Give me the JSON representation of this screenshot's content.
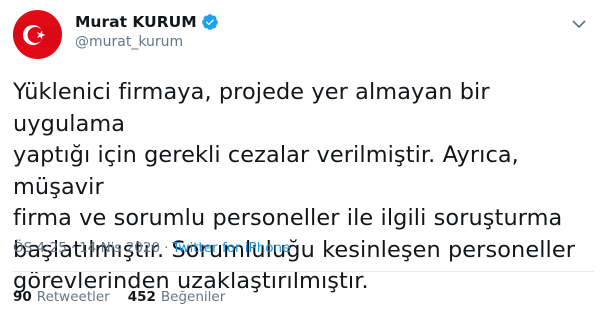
{
  "author": {
    "display_name": "Murat KURUM",
    "handle": "@murat_kurum",
    "verified": true,
    "avatar_icon": "turkish-flag-avatar",
    "avatar_colors": {
      "field": "#e30a17",
      "emblem": "#ffffff"
    }
  },
  "tweet": {
    "lines": [
      "Yüklenici firmaya, projede yer almayan bir uygulama",
      "yaptığı için gerekli cezalar verilmiştir. Ayrıca, müşavir",
      "firma ve sorumlu personeller ile ilgili soruşturma",
      "başlatılmıştır. Sorumluluğu kesinleşen personeller",
      "görevlerinden uzaklaştırılmıştır."
    ]
  },
  "meta": {
    "time": "ÖS 4:25",
    "separator": "·",
    "date": "14 Nis 2020",
    "source": "Twitter for iPhone"
  },
  "stats": {
    "retweets_count": "90",
    "retweets_label": "Retweetler",
    "likes_count": "452",
    "likes_label": "Beğeniler"
  },
  "colors": {
    "text": "#14171a",
    "secondary": "#657786",
    "link": "#1b95e0",
    "verified": "#1da1f2"
  },
  "icons": {
    "verified": "verified-badge-icon",
    "caret": "chevron-down-icon"
  }
}
